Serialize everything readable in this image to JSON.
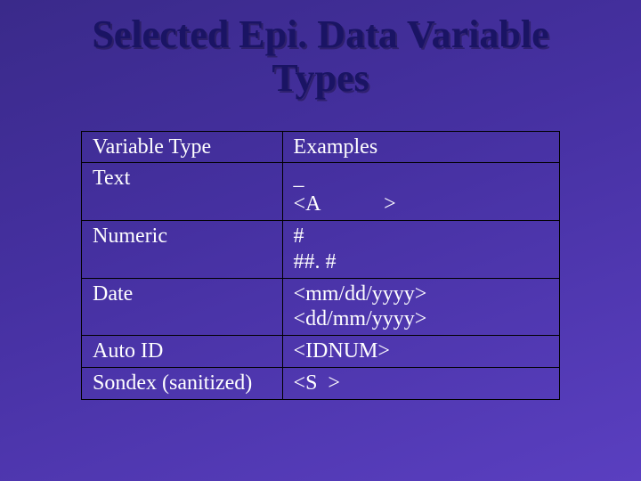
{
  "title_line1": "Selected Epi. Data Variable",
  "title_line2": "Types",
  "headers": {
    "type": "Variable Type",
    "examples": "Examples"
  },
  "rows": [
    {
      "type": "Text",
      "examples": "_\n<A            >"
    },
    {
      "type": "Numeric",
      "examples": "#\n##. #"
    },
    {
      "type": "Date",
      "examples": "<mm/dd/yyyy>\n<dd/mm/yyyy>"
    },
    {
      "type": "Auto ID",
      "examples": "<IDNUM>"
    },
    {
      "type": "Sondex (sanitized)",
      "examples": "<S  >"
    }
  ]
}
